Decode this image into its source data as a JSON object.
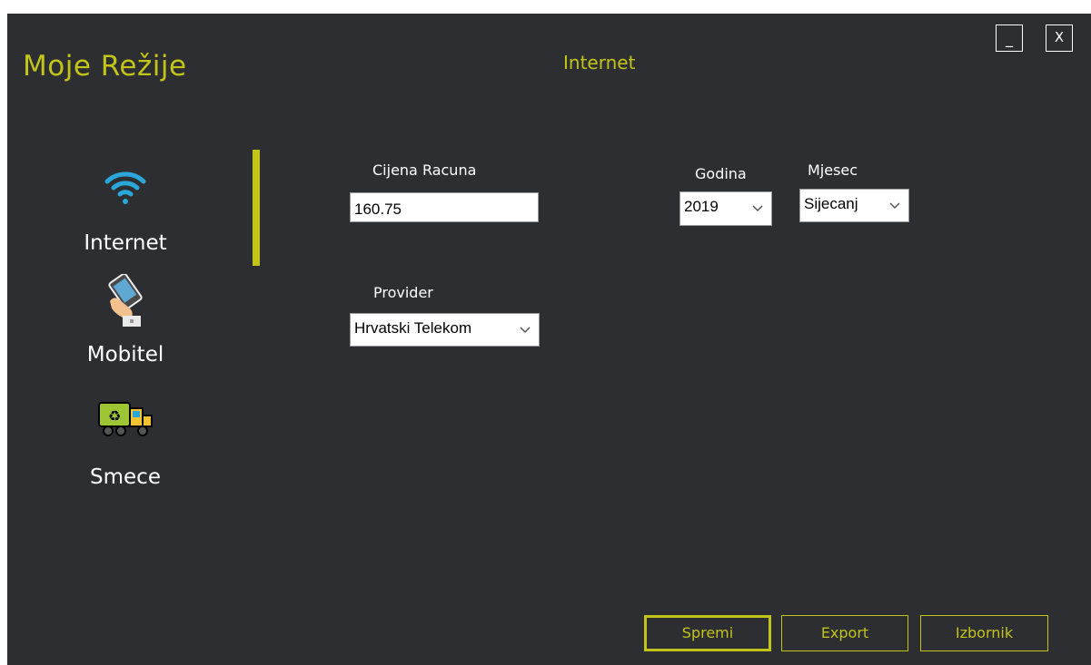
{
  "app": {
    "title": "Moje Režije"
  },
  "window_controls": {
    "minimize_label": "_",
    "close_label": "X"
  },
  "page": {
    "title": "Internet"
  },
  "sidebar": {
    "items": [
      {
        "label": "Internet",
        "icon": "wifi-icon",
        "active": true
      },
      {
        "label": "Mobitel",
        "icon": "mobile-phone-icon",
        "active": false
      },
      {
        "label": "Smece",
        "icon": "garbage-truck-icon",
        "active": false
      }
    ]
  },
  "form": {
    "price": {
      "label": "Cijena Racuna",
      "value": "160.75"
    },
    "year": {
      "label": "Godina",
      "selected": "2019"
    },
    "month": {
      "label": "Mjesec",
      "selected": "Sijecanj"
    },
    "provider": {
      "label": "Provider",
      "selected": "Hrvatski Telekom"
    }
  },
  "footer": {
    "save_label": "Spremi",
    "export_label": "Export",
    "menu_label": "Izbornik"
  },
  "colors": {
    "accent": "#c2c418",
    "background": "#2c2e32",
    "wifi": "#2aa7d8",
    "text": "#ffffff"
  }
}
